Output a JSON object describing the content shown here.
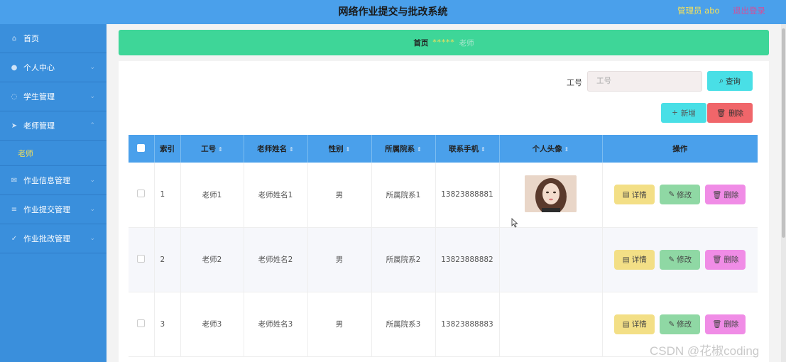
{
  "header": {
    "title": "网络作业提交与批改系统",
    "admin": "管理员 abo",
    "logout": "退出登录"
  },
  "sidebar": {
    "items": [
      {
        "label": "首页",
        "icon": "home-icon"
      },
      {
        "label": "个人中心",
        "icon": "user-icon"
      },
      {
        "label": "学生管理",
        "icon": "power-icon"
      },
      {
        "label": "老师管理",
        "icon": "send-icon"
      },
      {
        "label": "作业信息管理",
        "icon": "mail-icon"
      },
      {
        "label": "作业提交管理",
        "icon": "list-icon"
      },
      {
        "label": "作业批改管理",
        "icon": "check-circle-icon"
      }
    ],
    "sub_item": "老师"
  },
  "breadcrumb": {
    "home": "首页",
    "sep": "*****",
    "current": "老师"
  },
  "search": {
    "label": "工号",
    "placeholder": "工号",
    "query_button": "查询"
  },
  "actions": {
    "add": "新增",
    "delete": "删除"
  },
  "table": {
    "headers": [
      "索引",
      "工号",
      "老师姓名",
      "性别",
      "所属院系",
      "联系手机",
      "个人头像",
      "操作"
    ],
    "rows": [
      {
        "index": "1",
        "id": "老师1",
        "name": "老师姓名1",
        "gender": "男",
        "dept": "所属院系1",
        "phone": "13823888881"
      },
      {
        "index": "2",
        "id": "老师2",
        "name": "老师姓名2",
        "gender": "男",
        "dept": "所属院系2",
        "phone": "13823888882"
      },
      {
        "index": "3",
        "id": "老师3",
        "name": "老师姓名3",
        "gender": "男",
        "dept": "所属院系3",
        "phone": "13823888883"
      }
    ],
    "op_labels": {
      "detail": "详情",
      "edit": "修改",
      "delete": "删除"
    }
  },
  "watermark": "CSDN @花椒coding"
}
